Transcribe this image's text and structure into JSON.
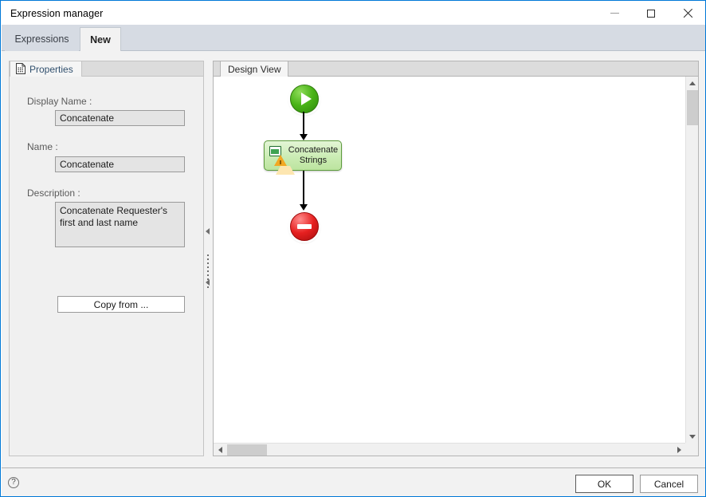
{
  "window": {
    "title": "Expression manager",
    "controls": {
      "minimize": "minimize",
      "maximize": "maximize",
      "close": "close"
    }
  },
  "tabs": [
    {
      "label": "Expressions",
      "active": false
    },
    {
      "label": "New",
      "active": true
    }
  ],
  "properties_panel": {
    "tab_label": "Properties",
    "tab_icon": "document-grid-icon",
    "fields": [
      {
        "label": "Display Name :",
        "value": "Concatenate",
        "type": "text"
      },
      {
        "label": "Name :",
        "value": "Concatenate",
        "type": "text"
      },
      {
        "label": "Description :",
        "value": "Concatenate Requester's first and last name",
        "type": "textarea"
      }
    ],
    "copy_from_button": "Copy from ..."
  },
  "splitter": {
    "collapse_top_icon": "triangle-left-icon",
    "collapse_bottom_icon": "triangle-left-icon",
    "grip": "dotted-grip"
  },
  "design_view": {
    "tab_label": "Design View",
    "nodes": [
      {
        "id": "start",
        "type": "start",
        "icon": "play-icon",
        "label": ""
      },
      {
        "id": "task",
        "type": "activity",
        "icon": "display-icon",
        "badge": "warning-icon",
        "label_line1": "Concatenate",
        "label_line2": "Strings"
      },
      {
        "id": "end",
        "type": "end",
        "icon": "stop-icon",
        "label": ""
      }
    ],
    "connections": [
      {
        "from": "start",
        "to": "task"
      },
      {
        "from": "task",
        "to": "end"
      }
    ],
    "scrollbars": {
      "vertical": {
        "up_icon": "arrow-up-icon",
        "down_icon": "arrow-down-icon"
      },
      "horizontal": {
        "left_icon": "arrow-left-icon",
        "right_icon": "arrow-right-icon"
      }
    }
  },
  "footer": {
    "help_icon": "question-mark-icon",
    "ok_label": "OK",
    "cancel_label": "Cancel"
  },
  "colors": {
    "window_border": "#0078d7",
    "tabstrip": "#d6dbe3",
    "active_tab": "#f2f2f2",
    "node_start_green": "#49b317",
    "node_end_red": "#e62020",
    "node_task_green": "#cbecb4",
    "warning_orange": "#f2a823"
  }
}
